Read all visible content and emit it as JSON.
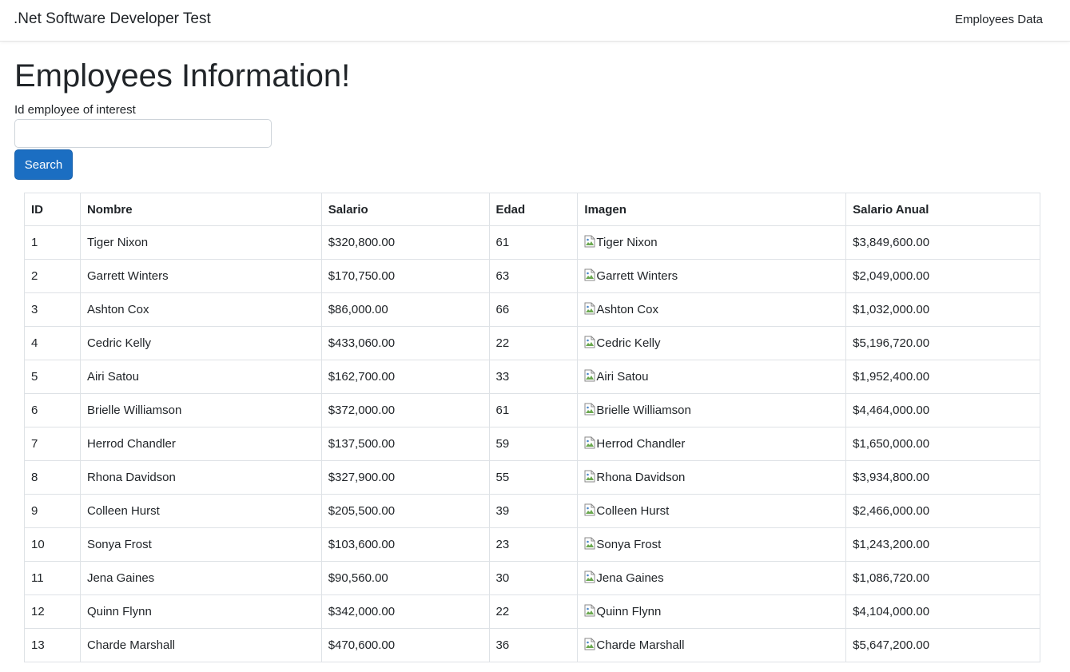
{
  "navbar": {
    "brand": ".Net Software Developer Test",
    "link": "Employees Data"
  },
  "main": {
    "title": "Employees Information!",
    "input_label": "Id employee of interest",
    "input_value": "",
    "search_label": "Search"
  },
  "table": {
    "headers": [
      "ID",
      "Nombre",
      "Salario",
      "Edad",
      "Imagen",
      "Salario Anual"
    ],
    "rows": [
      {
        "id": "1",
        "nombre": "Tiger Nixon",
        "salario": "$320,800.00",
        "edad": "61",
        "imagen": "Tiger Nixon",
        "anual": "$3,849,600.00"
      },
      {
        "id": "2",
        "nombre": "Garrett Winters",
        "salario": "$170,750.00",
        "edad": "63",
        "imagen": "Garrett Winters",
        "anual": "$2,049,000.00"
      },
      {
        "id": "3",
        "nombre": "Ashton Cox",
        "salario": "$86,000.00",
        "edad": "66",
        "imagen": "Ashton Cox",
        "anual": "$1,032,000.00"
      },
      {
        "id": "4",
        "nombre": "Cedric Kelly",
        "salario": "$433,060.00",
        "edad": "22",
        "imagen": "Cedric Kelly",
        "anual": "$5,196,720.00"
      },
      {
        "id": "5",
        "nombre": "Airi Satou",
        "salario": "$162,700.00",
        "edad": "33",
        "imagen": "Airi Satou",
        "anual": "$1,952,400.00"
      },
      {
        "id": "6",
        "nombre": "Brielle Williamson",
        "salario": "$372,000.00",
        "edad": "61",
        "imagen": "Brielle Williamson",
        "anual": "$4,464,000.00"
      },
      {
        "id": "7",
        "nombre": "Herrod Chandler",
        "salario": "$137,500.00",
        "edad": "59",
        "imagen": "Herrod Chandler",
        "anual": "$1,650,000.00"
      },
      {
        "id": "8",
        "nombre": "Rhona Davidson",
        "salario": "$327,900.00",
        "edad": "55",
        "imagen": "Rhona Davidson",
        "anual": "$3,934,800.00"
      },
      {
        "id": "9",
        "nombre": "Colleen Hurst",
        "salario": "$205,500.00",
        "edad": "39",
        "imagen": "Colleen Hurst",
        "anual": "$2,466,000.00"
      },
      {
        "id": "10",
        "nombre": "Sonya Frost",
        "salario": "$103,600.00",
        "edad": "23",
        "imagen": "Sonya Frost",
        "anual": "$1,243,200.00"
      },
      {
        "id": "11",
        "nombre": "Jena Gaines",
        "salario": "$90,560.00",
        "edad": "30",
        "imagen": "Jena Gaines",
        "anual": "$1,086,720.00"
      },
      {
        "id": "12",
        "nombre": "Quinn Flynn",
        "salario": "$342,000.00",
        "edad": "22",
        "imagen": "Quinn Flynn",
        "anual": "$4,104,000.00"
      },
      {
        "id": "13",
        "nombre": "Charde Marshall",
        "salario": "$470,600.00",
        "edad": "36",
        "imagen": "Charde Marshall",
        "anual": "$5,647,200.00"
      }
    ]
  },
  "icons": {
    "broken_image": "broken-image-icon"
  },
  "colors": {
    "primary": "#1b6ec2",
    "border": "#dee2e6",
    "text": "#212529"
  }
}
